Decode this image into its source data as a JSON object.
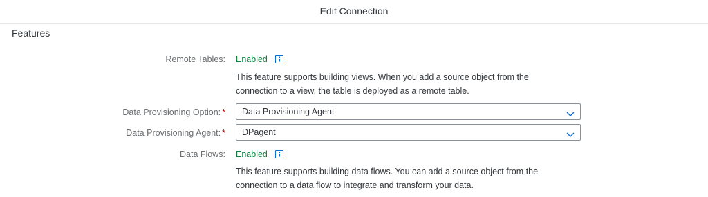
{
  "header": {
    "title": "Edit Connection"
  },
  "section": {
    "title": "Features"
  },
  "remote_tables": {
    "label": "Remote Tables:",
    "status": "Enabled",
    "line1": "This feature supports building views. When you add a source object from the",
    "line2": "connection to a view, the table is deployed as a remote table."
  },
  "dp_option": {
    "label": "Data Provisioning Option:",
    "required": "*",
    "value": "Data Provisioning Agent"
  },
  "dp_agent": {
    "label": "Data Provisioning Agent:",
    "required": "*",
    "value": "DPagent"
  },
  "data_flows": {
    "label": "Data Flows:",
    "status": "Enabled",
    "line1": "This feature supports building data flows. You can add a source object from the",
    "line2": "connection to a data flow to integrate and transform your data."
  },
  "icons": {
    "info": "info-icon",
    "dropdown": "chevron-down-icon"
  },
  "colors": {
    "enabled": "#107e3e",
    "required": "#bb0000",
    "info": "#0a6ed1"
  }
}
